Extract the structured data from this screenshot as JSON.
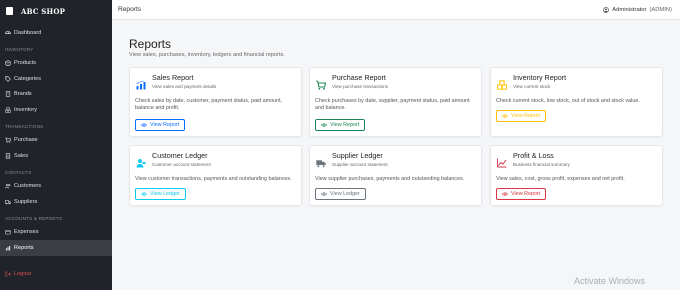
{
  "sidebar": {
    "brand": "ABC SHOP",
    "items": {
      "dashboard": "Dashboard",
      "products": "Products",
      "categories": "Categories",
      "brands": "Brands",
      "inventory": "Inventory",
      "purchase": "Purchase",
      "sales": "Sales",
      "customers": "Customers",
      "suppliers": "Suppliers",
      "expenses": "Expenses",
      "reports": "Reports",
      "logout": "Logout"
    },
    "sections": {
      "inventory": "INVENTORY",
      "transactions": "TRANSACTIONS",
      "contacts": "CONTACTS",
      "accounts_reports": "ACCOUNTS & REPORTS"
    },
    "active_item": "Reports"
  },
  "topbar": {
    "title": "Reports",
    "user_name": "Administrator",
    "user_role": "(ADMIN)"
  },
  "main": {
    "title": "Reports",
    "subtitle": "View sales, purchases, inventory, ledgers and financial reports."
  },
  "cards": [
    {
      "title": "Sales Report",
      "subtitle": "View sales and payment details",
      "description": "Check sales by date, customer, payment status, paid amount, balance and profit.",
      "button": "View Report",
      "color": "#0d6efd",
      "icon": "bar-chart-icon"
    },
    {
      "title": "Purchase Report",
      "subtitle": "View purchase transactions",
      "description": "Check purchases by date, supplier, payment status, paid amount and balance.",
      "button": "View Report",
      "color": "#198754",
      "icon": "cart-icon"
    },
    {
      "title": "Inventory Report",
      "subtitle": "View current stock",
      "description": "Check current stock, low stock, out of stock and stock value.",
      "button": "View Report",
      "color": "#ffc107",
      "icon": "boxes-icon"
    },
    {
      "title": "Customer Ledger",
      "subtitle": "Customer account statement",
      "description": "View customer transactions, payments and outstanding balances.",
      "button": "View Ledger",
      "color": "#0dcaf0",
      "icon": "customer-icon"
    },
    {
      "title": "Supplier Ledger",
      "subtitle": "Supplier account statement",
      "description": "View supplier purchases, payments and outstanding balances.",
      "button": "View Ledger",
      "color": "#6c757d",
      "icon": "truck-icon"
    },
    {
      "title": "Profit & Loss",
      "subtitle": "Business financial summary",
      "description": "View sales, cost, gross profit, expenses and net profit.",
      "button": "View Report",
      "color": "#dc3545",
      "icon": "trend-icon"
    }
  ],
  "watermark": "Activate Windows"
}
